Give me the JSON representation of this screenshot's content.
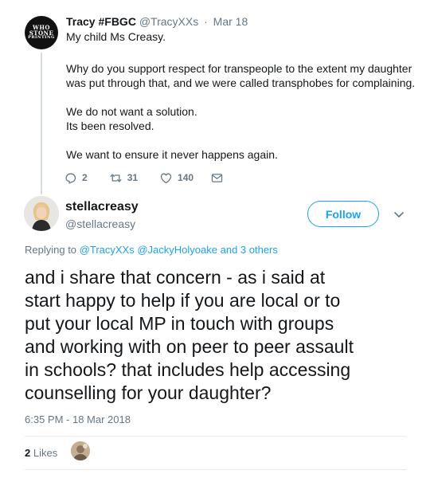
{
  "parent_tweet": {
    "display_name": "Tracy #FBGC",
    "handle": "@TracyXXs",
    "separator": "·",
    "date": "Mar 18",
    "avatar_text": [
      "WHO",
      "STONE",
      "PRINTING"
    ],
    "lines": [
      "My child Ms Creasy.",
      "Why do you support respect for transpeople to the extent my daughter",
      "was put through that, and we were called transphobes for complaining.",
      "We do not want a solution.",
      "Its been resolved.",
      "We want to ensure it never happens again."
    ],
    "actions": {
      "replies": "2",
      "retweets": "31",
      "likes": "140"
    }
  },
  "main_tweet": {
    "display_name": "stellacreasy",
    "handle": "@stellacreasy",
    "follow_label": "Follow",
    "replying_prefix": "Replying to",
    "replying_mentions": [
      "@TracyXXs",
      "@JackyHolyoake"
    ],
    "replying_suffix": "and 3 others",
    "body_lines": [
      "and i share that concern - as i said at",
      "start happy to help if you are local or to",
      "put your local MP in touch with groups",
      "and working with on peer to peer assault",
      "in schools?  that includes help accessing",
      "counselling for your daughter?"
    ],
    "timestamp": "6:35 PM - 18 Mar 2018",
    "likes_count": "2",
    "likes_label": "Likes"
  },
  "colors": {
    "accent": "#1da1f2",
    "secondary_text": "#657786",
    "primary_text": "#14171a",
    "divider": "#e6ecf0",
    "thread_line": "#d5dde3"
  },
  "icons": [
    "reply-icon",
    "retweet-icon",
    "like-icon",
    "direct-message-icon",
    "chevron-down-icon"
  ]
}
